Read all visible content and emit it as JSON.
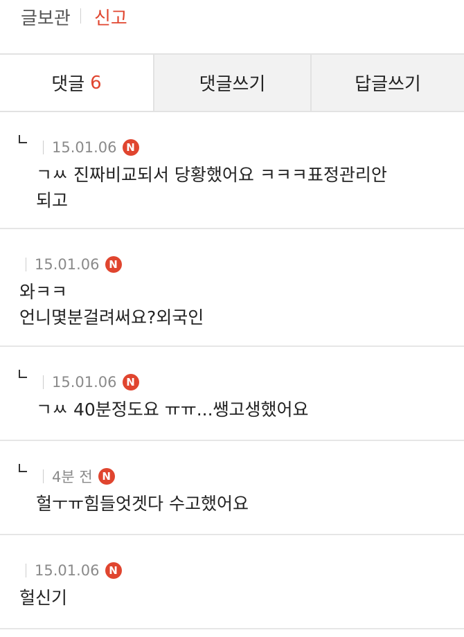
{
  "header": {
    "save_label": "글보관",
    "report_label": "신고"
  },
  "tabs": {
    "comments_label": "댓글",
    "comments_count": "6",
    "write_comment_label": "댓글쓰기",
    "write_reply_label": "답글쓰기"
  },
  "comments": [
    {
      "is_reply": true,
      "date": "15.01.06",
      "badge": "N",
      "text": "ㄱㅆ 진짜비교되서 당황했어요 ㅋㅋㅋ표정관리안\n되고"
    },
    {
      "is_reply": false,
      "date": "15.01.06",
      "badge": "N",
      "text": "와ㅋㅋ\n언니몇분걸려써요?외국인"
    },
    {
      "is_reply": true,
      "date": "15.01.06",
      "badge": "N",
      "text": "ㄱㅆ 40분정도요 ㅠㅠ...쌩고생했어요"
    },
    {
      "is_reply": true,
      "date": "4분 전",
      "badge": "N",
      "text": "헐ㅜㅠ힘들엇겟다 수고했어요"
    },
    {
      "is_reply": false,
      "date": "15.01.06",
      "badge": "N",
      "text": "헐신기"
    }
  ],
  "colors": {
    "accent": "#e0452f",
    "meta_text": "#8a8a8a",
    "tab_inactive_bg": "#f2f2f2",
    "divider": "#e2e2e2"
  }
}
